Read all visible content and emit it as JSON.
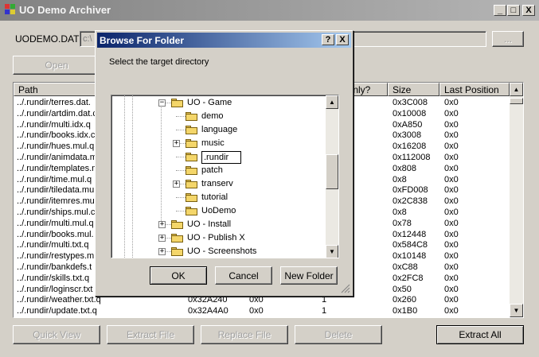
{
  "window": {
    "title": "UO Demo Archiver",
    "minimize": "_",
    "maximize": "□",
    "close": "X"
  },
  "top": {
    "file_label": "UODEMO.DAT",
    "path_value": "c:\\",
    "browse_label": "...",
    "open_label": "Open"
  },
  "list": {
    "columns": [
      "Path",
      "Only?",
      "Size",
      "Last Position"
    ],
    "rows": [
      {
        "path": "../.rundir/terres.dat.",
        "size": "0x3C008",
        "last": "0x0"
      },
      {
        "path": "../.rundir/artdim.dat.c",
        "size": "0x10008",
        "last": "0x0"
      },
      {
        "path": "../.rundir/multi.idx.q",
        "size": "0xA850",
        "last": "0x0"
      },
      {
        "path": "../.rundir/books.idx.c",
        "size": "0x3008",
        "last": "0x0"
      },
      {
        "path": "../.rundir/hues.mul.q",
        "size": "0x16208",
        "last": "0x0"
      },
      {
        "path": "../.rundir/animdata.m",
        "size": "0x112008",
        "last": "0x0"
      },
      {
        "path": "../.rundir/templates.m",
        "size": "0x808",
        "last": "0x0"
      },
      {
        "path": "../.rundir/time.mul.q",
        "size": "0x8",
        "last": "0x0"
      },
      {
        "path": "../.rundir/tiledata.mu",
        "size": "0xFD008",
        "last": "0x0"
      },
      {
        "path": "../.rundir/itemres.mul",
        "size": "0x2C838",
        "last": "0x0"
      },
      {
        "path": "../.rundir/ships.mul.c",
        "size": "0x8",
        "last": "0x0"
      },
      {
        "path": "../.rundir/multi.mul.q",
        "size": "0x78",
        "last": "0x0"
      },
      {
        "path": "../.rundir/books.mul.",
        "size": "0x12448",
        "last": "0x0"
      },
      {
        "path": "../.rundir/multi.txt.q",
        "size": "0x584C8",
        "last": "0x0"
      },
      {
        "path": "../.rundir/restypes.m",
        "size": "0x10148",
        "last": "0x0"
      },
      {
        "path": "../.rundir/bankdefs.t",
        "size": "0xC88",
        "last": "0x0"
      },
      {
        "path": "../.rundir/skills.txt.q",
        "size": "0x2FC8",
        "last": "0x0"
      },
      {
        "path": "../.rundir/loginscr.txt",
        "size": "0x50",
        "last": "0x0"
      },
      {
        "path": "../.rundir/weather.txt.q",
        "offset": "0x32A240",
        "c3": "0x0",
        "c4": "1",
        "size": "0x260",
        "last": "0x0"
      },
      {
        "path": "../.rundir/update.txt.q",
        "offset": "0x32A4A0",
        "c3": "0x0",
        "c4": "1",
        "size": "0x1B0",
        "last": "0x0"
      }
    ]
  },
  "bottom": {
    "quick_view": "Quick View",
    "extract_file": "Extract File",
    "replace_file": "Replace File",
    "delete": "Delete",
    "extract_all": "Extract All"
  },
  "dialog": {
    "title": "Browse For Folder",
    "help": "?",
    "close": "X",
    "instruction": "Select the target directory",
    "tree": [
      {
        "label": "UO - Game",
        "level": 0,
        "expander": "−"
      },
      {
        "label": "demo",
        "level": 1,
        "expander": ""
      },
      {
        "label": "language",
        "level": 1,
        "expander": ""
      },
      {
        "label": "music",
        "level": 1,
        "expander": "+"
      },
      {
        "label": ".rundir",
        "level": 1,
        "expander": "",
        "editing": true
      },
      {
        "label": "patch",
        "level": 1,
        "expander": ""
      },
      {
        "label": "transerv",
        "level": 1,
        "expander": "+"
      },
      {
        "label": "tutorial",
        "level": 1,
        "expander": ""
      },
      {
        "label": "UoDemo",
        "level": 1,
        "expander": ""
      },
      {
        "label": "UO - Install",
        "level": 0,
        "expander": "+"
      },
      {
        "label": "UO - Publish X",
        "level": 0,
        "expander": "+"
      },
      {
        "label": "UO - Screenshots",
        "level": 0,
        "expander": "+"
      }
    ],
    "ok": "OK",
    "cancel": "Cancel",
    "new_folder": "New Folder"
  }
}
